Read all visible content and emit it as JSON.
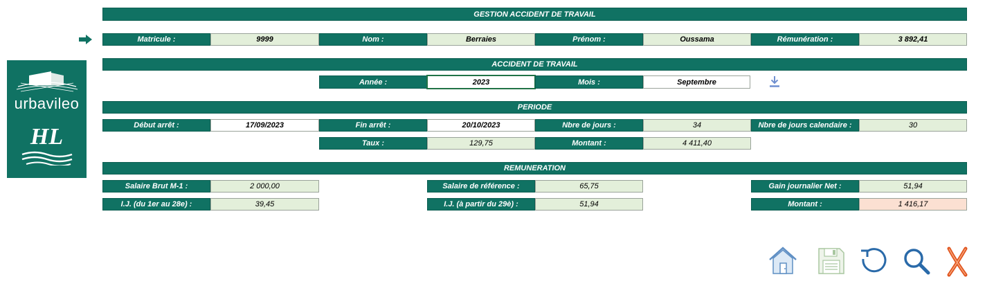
{
  "header": {
    "title": "GESTION ACCIDENT DE TRAVAIL"
  },
  "employee": {
    "matricule_label": "Matricule :",
    "matricule_value": "9999",
    "nom_label": "Nom :",
    "nom_value": "Berraies",
    "prenom_label": "Prénom :",
    "prenom_value": "Oussama",
    "remuneration_label": "Rémunération :",
    "remuneration_value": "3 892,41"
  },
  "accident": {
    "title": "ACCIDENT DE TRAVAIL",
    "annee_label": "Année :",
    "annee_value": "2023",
    "mois_label": "Mois :",
    "mois_value": "Septembre"
  },
  "periode": {
    "title": "PERIODE",
    "debut_label": "Début arrêt :",
    "debut_value": "17/09/2023",
    "fin_label": "Fin arrêt :",
    "fin_value": "20/10/2023",
    "nbre_jours_label": "Nbre de jours :",
    "nbre_jours_value": "34",
    "nbre_jours_cal_label": "Nbre de jours calendaire :",
    "nbre_jours_cal_value": "30",
    "taux_label": "Taux :",
    "taux_value": "129,75",
    "montant_label": "Montant :",
    "montant_value": "4 411,40"
  },
  "remuneration": {
    "title": "REMUNERATION",
    "salaire_brut_label": "Salaire Brut M-1 :",
    "salaire_brut_value": "2 000,00",
    "salaire_ref_label": "Salaire de référence :",
    "salaire_ref_value": "65,75",
    "gain_label": "Gain journalier Net :",
    "gain_value": "51,94",
    "ij1_label": "I.J. (du 1er au 28e) :",
    "ij1_value": "39,45",
    "ij2_label": "I.J. (à partir du 29è) :",
    "ij2_value": "51,94",
    "montant_label": "Montant :",
    "montant_value": "1 416,17"
  },
  "logo": {
    "brand": "urbavileo",
    "mark": "HL"
  },
  "colors": {
    "header_green": "#107263",
    "value_green": "#e3efda",
    "highlight_peach": "#fbe0d2"
  },
  "icons": [
    "arrow-right-icon",
    "download-icon",
    "home-icon",
    "save-icon",
    "refresh-icon",
    "search-icon",
    "close-icon"
  ]
}
